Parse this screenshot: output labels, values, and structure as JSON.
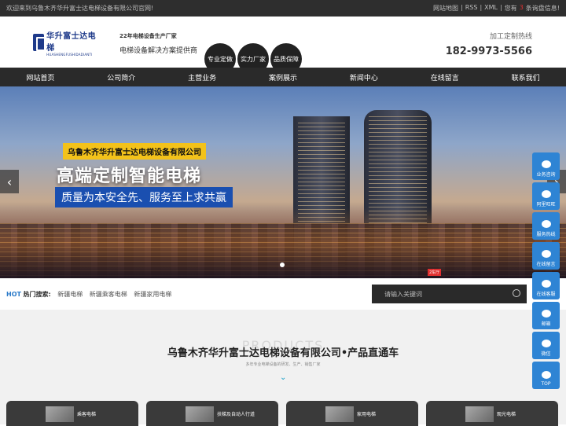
{
  "topbar": {
    "welcome": "欢迎来到乌鲁木齐华升富士达电梯设备有限公司官网!",
    "links": [
      "网站地图",
      "|",
      "RSS",
      "|",
      "XML",
      "|",
      "您有",
      "3",
      "条询盘信息!"
    ]
  },
  "header": {
    "logo_cn": "华升富士达电梯",
    "logo_en": "HUASHENGFUSHIDADIANTI",
    "slogan_line1": "22年电梯设备生产厂家",
    "slogan_line2": "电梯设备解决方案提供商",
    "badges": [
      "专业定做",
      "实力厂家",
      "品质保障"
    ],
    "hotline_label": "加工定制热线",
    "hotline_number": "182-9973-5566"
  },
  "nav": [
    "网站首页",
    "公司简介",
    "主营业务",
    "案例展示",
    "新闻中心",
    "在线留言",
    "联系我们"
  ],
  "banner": {
    "company": "乌鲁木齐华升富士达电梯设备有限公司",
    "title": "高端定制智能电梯",
    "subtitle": "质量为本安全先、服务至上求共赢",
    "stamp": "2车厅",
    "prev_icon": "‹",
    "next_icon": "›"
  },
  "search": {
    "hot_tag": "HOT",
    "hot_label": "热门搜索:",
    "keywords": [
      "新疆电梯",
      "新疆乘客电梯",
      "新疆家用电梯"
    ],
    "placeholder": "请输入关键词"
  },
  "products": {
    "watermark": "PRODUCTS",
    "title": "乌鲁木齐华升富士达电梯设备有限公司•产品直通车",
    "subtitle": "多年专业电梯设备的研发、生产、销售厂家",
    "chevron": "⌄",
    "cards": [
      "乘客电梯",
      "扶梯及自动人行道",
      "家用电梯",
      "观光电梯"
    ]
  },
  "sidebar": [
    "业务咨询",
    "阿里旺旺",
    "服务热线",
    "在线留言",
    "在线客服",
    "邮箱",
    "微信",
    "TOP"
  ],
  "colors": {
    "accent_blue": "#2e84d4",
    "nav_bg": "#2a2a2a",
    "banner_yellow": "#f3c21a",
    "banner_blue": "#1a4fb0"
  }
}
